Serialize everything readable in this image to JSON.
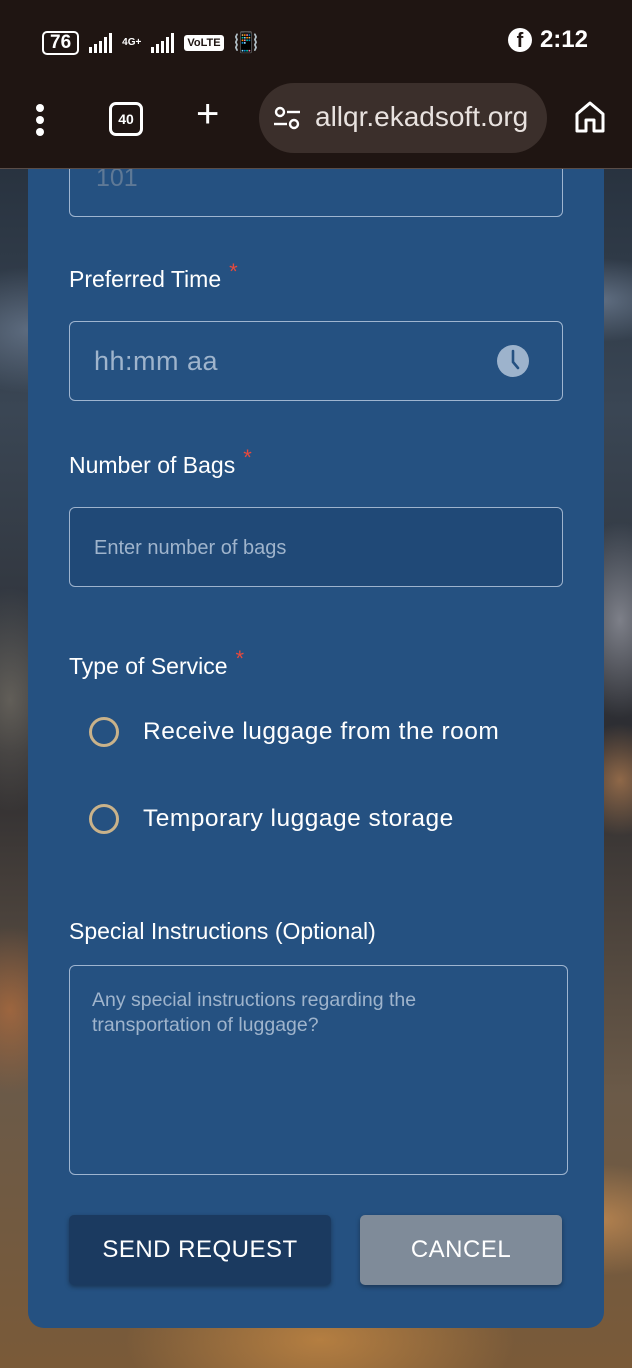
{
  "status_bar": {
    "battery": "76",
    "network_label": "4G+",
    "volte_label": "VoLTE",
    "time": "2:12"
  },
  "browser": {
    "tab_count": "40",
    "url": "allqr.ekadsoft.org"
  },
  "form": {
    "room_field": {
      "value": "101"
    },
    "preferred_time": {
      "label": "Preferred Time",
      "required_mark": "*",
      "placeholder": "hh:mm aa"
    },
    "number_of_bags": {
      "label": "Number of Bags",
      "required_mark": "*",
      "placeholder": "Enter number of bags"
    },
    "type_of_service": {
      "label": "Type of Service",
      "required_mark": "*",
      "options": [
        {
          "label": "Receive luggage from the room",
          "selected": false
        },
        {
          "label": "Temporary luggage storage",
          "selected": false
        }
      ]
    },
    "special_instructions": {
      "label": "Special Instructions (Optional)",
      "placeholder": "Any special instructions regarding the transportation of luggage?"
    },
    "send_label": "SEND REQUEST",
    "cancel_label": "CANCEL"
  },
  "colors": {
    "card_bg": "#255181",
    "send_button_bg": "#1b3a60",
    "cancel_button_bg": "#7f8b99",
    "required_mark": "#e64a3d",
    "radio_ring": "#c9b28a"
  }
}
